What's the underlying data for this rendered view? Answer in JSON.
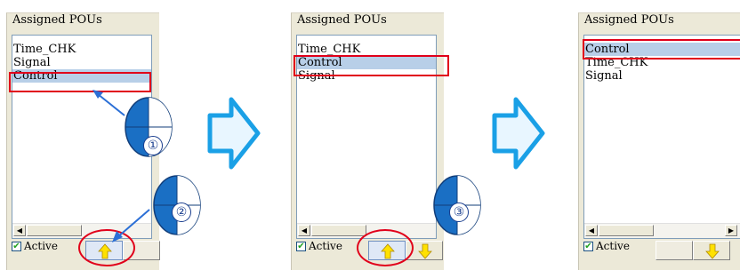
{
  "panels": [
    {
      "title": "Assigned POUs",
      "items": [
        {
          "label": "Time_CHK",
          "selected": false
        },
        {
          "label": "Signal",
          "selected": false
        },
        {
          "label": "Control",
          "selected": true
        }
      ],
      "active_label": "Active",
      "active_checked": true,
      "step_label": "①",
      "step_label_2": "②"
    },
    {
      "title": "Assigned POUs",
      "items": [
        {
          "label": "Time_CHK",
          "selected": false
        },
        {
          "label": "Control",
          "selected": true
        },
        {
          "label": "Signal",
          "selected": false
        }
      ],
      "active_label": "Active",
      "active_checked": true,
      "step_label": "③"
    },
    {
      "title": "Assigned POUs",
      "items": [
        {
          "label": "Control",
          "selected": true
        },
        {
          "label": "Time_CHK",
          "selected": false
        },
        {
          "label": "Signal",
          "selected": false
        }
      ],
      "active_label": "Active",
      "active_checked": true
    }
  ],
  "icons": {
    "move_up": "up-arrow-icon",
    "move_down": "down-arrow-icon",
    "step_flow": "right-arrow-icon",
    "mouse": "mouse-icon"
  },
  "colors": {
    "highlight": "#e1001a",
    "selection": "#b8cfe8",
    "flow_arrow": "#1aa0e6",
    "button_arrow": "#ffe100"
  }
}
